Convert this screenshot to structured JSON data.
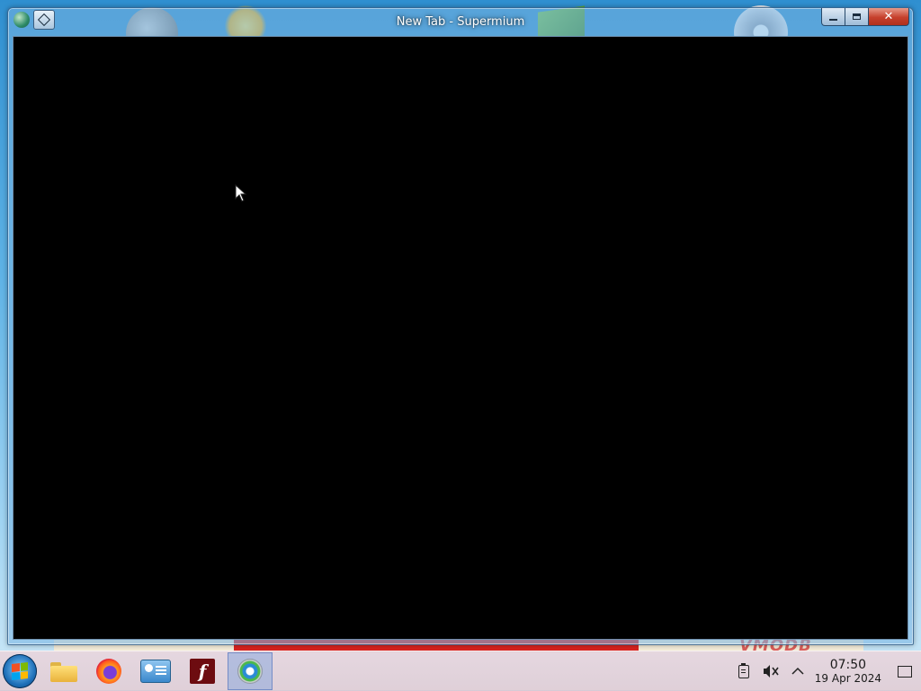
{
  "window": {
    "title": "New Tab - Supermium",
    "controls": {
      "minimize": "minimize",
      "maximize": "maximize",
      "close": "✕"
    }
  },
  "content": {
    "background": "#000000"
  },
  "desktop": {
    "watermark": "VMODB"
  },
  "taskbar": {
    "start_icon": "windows-start-orb",
    "pinned": [
      {
        "name": "file-explorer",
        "icon": "folder-icon",
        "active": false
      },
      {
        "name": "firefox",
        "icon": "firefox-icon",
        "active": false
      },
      {
        "name": "contacts",
        "icon": "contacts-icon",
        "active": false
      },
      {
        "name": "adobe-flash",
        "icon": "flash-icon",
        "label": "f",
        "active": false
      },
      {
        "name": "supermium",
        "icon": "supermium-icon",
        "active": true
      }
    ],
    "tray": {
      "icons": [
        "clipboard-icon",
        "volume-muted-icon",
        "chevron-up-icon"
      ],
      "clock": {
        "time": "07:50",
        "date": "19 Apr 2024"
      },
      "notifications_icon": "notification-icon"
    }
  },
  "colors": {
    "accent": "#1e6fb8",
    "close_button": "#c6402c",
    "taskbar": "#e5d3da",
    "active_item": "#8caadc"
  }
}
